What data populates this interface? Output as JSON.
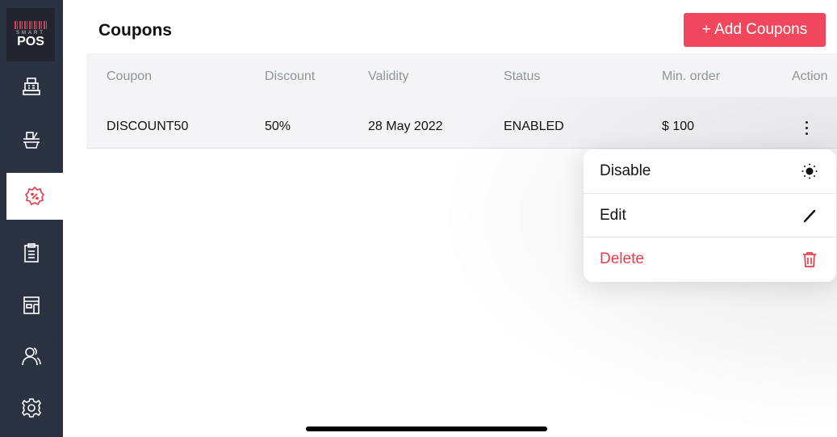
{
  "app": {
    "logo_smart": "SMART",
    "logo_pos": "POS"
  },
  "colors": {
    "sidebar": "#2b3241",
    "accent": "#f0475c",
    "danger": "#ea3d4b"
  },
  "sidebar": {
    "items": [
      {
        "icon": "cash-register-icon",
        "active": false
      },
      {
        "icon": "basket-icon",
        "active": false
      },
      {
        "icon": "discount-badge-icon",
        "active": true
      },
      {
        "icon": "clipboard-icon",
        "active": false
      },
      {
        "icon": "store-icon",
        "active": false
      },
      {
        "icon": "users-icon",
        "active": false
      },
      {
        "icon": "settings-icon",
        "active": false
      }
    ]
  },
  "header": {
    "title": "Coupons",
    "add_button": "+ Add Coupons"
  },
  "table": {
    "columns": [
      "Coupon",
      "Discount",
      "Validity",
      "Status",
      "Min. order",
      "Action"
    ],
    "rows": [
      [
        "DISCOUNT50",
        "50%",
        "28 May 2022",
        "ENABLED",
        "$ 100"
      ]
    ]
  },
  "menu": {
    "items": [
      {
        "label": "Disable",
        "icon": "sun-icon"
      },
      {
        "label": "Edit",
        "icon": "pencil-icon"
      },
      {
        "label": "Delete",
        "icon": "trash-icon"
      }
    ]
  }
}
